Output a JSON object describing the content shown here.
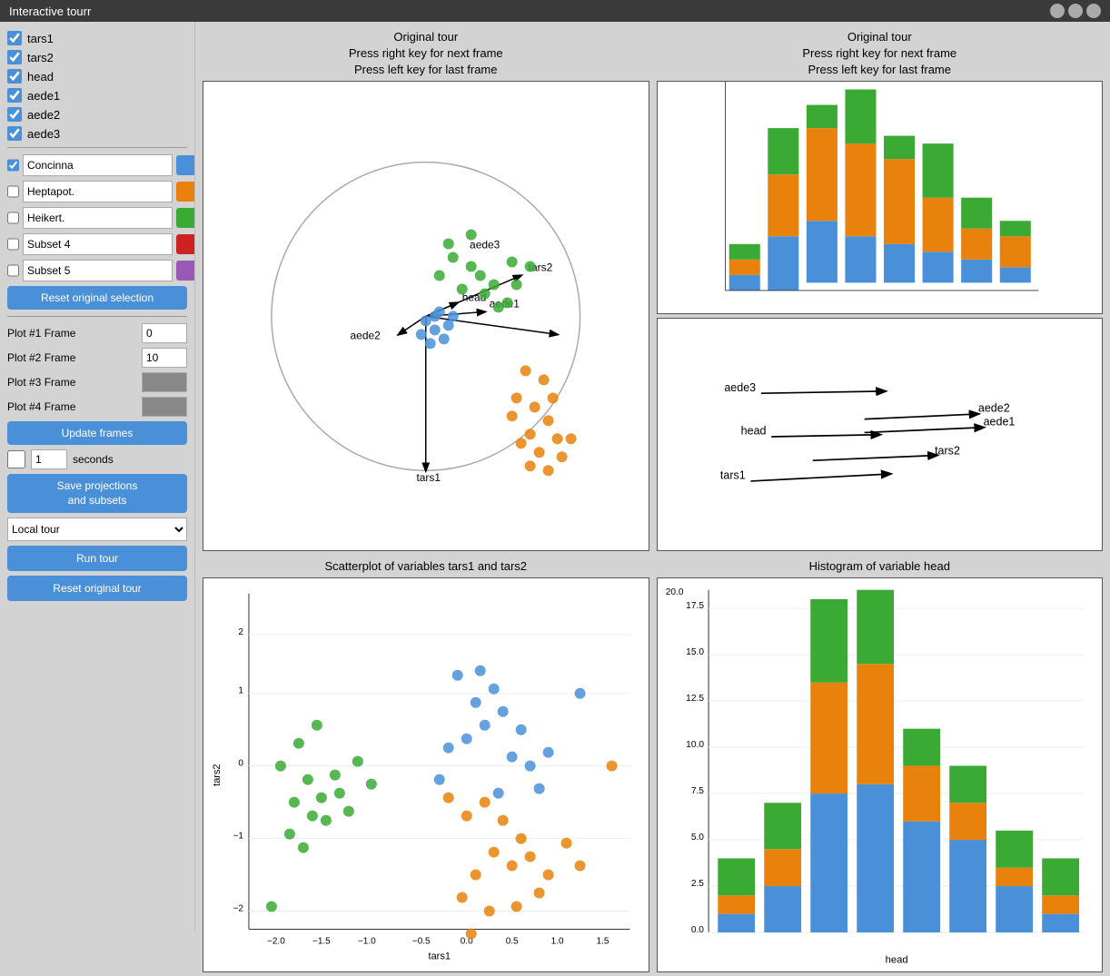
{
  "app": {
    "title": "Interactive tourr"
  },
  "sidebar": {
    "variables": [
      {
        "label": "tars1",
        "checked": true
      },
      {
        "label": "tars2",
        "checked": true
      },
      {
        "label": "head",
        "checked": true
      },
      {
        "label": "aede1",
        "checked": true
      },
      {
        "label": "aede2",
        "checked": true
      },
      {
        "label": "aede3",
        "checked": true
      }
    ],
    "subsets": [
      {
        "label": "Concinna",
        "checked": true,
        "color": "#4a90d9"
      },
      {
        "label": "Heptapot.",
        "checked": false,
        "color": "#e8820c"
      },
      {
        "label": "Heikert.",
        "checked": false,
        "color": "#3aaa35"
      },
      {
        "label": "Subset 4",
        "checked": false,
        "color": "#cc2222"
      },
      {
        "label": "Subset 5",
        "checked": false,
        "color": "#9b59b6"
      }
    ],
    "reset_selection_label": "Reset original selection",
    "frames": [
      {
        "label": "Plot #1 Frame",
        "value": "0",
        "type": "input"
      },
      {
        "label": "Plot #2 Frame",
        "value": "10",
        "type": "input"
      },
      {
        "label": "Plot #3 Frame",
        "value": "",
        "type": "color"
      },
      {
        "label": "Plot #4 Frame",
        "value": "",
        "type": "color"
      }
    ],
    "update_frames_label": "Update frames",
    "seconds_value": "1",
    "seconds_label": "seconds",
    "save_label": "Save projections\nand subsets",
    "local_tour_label": "Local tour",
    "run_tour_label": "Run tour",
    "reset_tour_label": "Reset original tour"
  },
  "plots": {
    "top_left": {
      "title_line1": "Original tour",
      "title_line2": "Press right key for next frame",
      "title_line3": "Press left key for last frame"
    },
    "top_right_hist": {
      "title_line1": "Original tour",
      "title_line2": "Press right key for next frame",
      "title_line3": "Press left key for last frame"
    },
    "bottom_left": {
      "title": "Scatterplot of variables tars1 and tars2",
      "xlabel": "tars1",
      "ylabel": "tars2"
    },
    "bottom_right": {
      "title": "Histogram of variable head",
      "xlabel": "head"
    }
  },
  "colors": {
    "blue": "#4a90d9",
    "orange": "#e8820c",
    "green": "#3aaa35"
  }
}
